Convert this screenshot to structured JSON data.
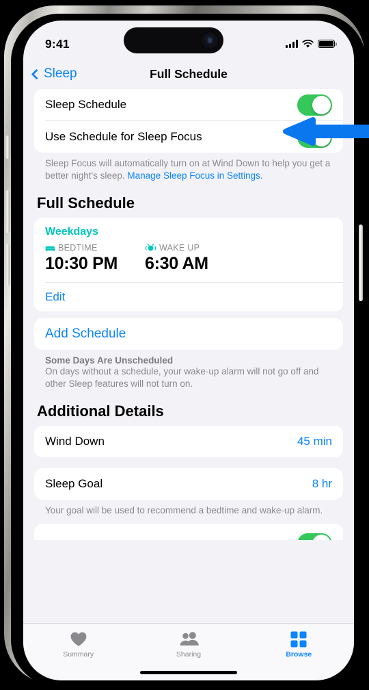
{
  "status_bar": {
    "time": "9:41",
    "cellular_icon": "cellular-bars-icon",
    "wifi_icon": "wifi-icon",
    "battery_icon": "battery-full-icon"
  },
  "nav": {
    "back_label": "Sleep",
    "back_icon": "chevron-left-icon",
    "title": "Full Schedule"
  },
  "schedule_toggles": {
    "rows": [
      {
        "label": "Sleep Schedule",
        "state": "on"
      },
      {
        "label": "Use Schedule for Sleep Focus",
        "state": "on"
      }
    ],
    "footnote_text": "Sleep Focus will automatically turn on at Wind Down to help you get a better night's sleep. ",
    "footnote_link": "Manage Sleep Focus in Settings."
  },
  "full_schedule": {
    "section_title": "Full Schedule",
    "weekdays_label": "Weekdays",
    "bedtime": {
      "icon": "bed-icon",
      "caption": "BEDTIME",
      "time": "10:30 PM"
    },
    "wake_up": {
      "icon": "alarm-clock-icon",
      "caption": "WAKE UP",
      "time": "6:30 AM"
    },
    "edit_label": "Edit",
    "add_schedule_label": "Add Schedule",
    "unscheduled_title": "Some Days Are Unscheduled",
    "unscheduled_text": "On days without a schedule, your wake-up alarm will not go off and other Sleep features will not turn on."
  },
  "additional_details": {
    "section_title": "Additional Details",
    "rows": [
      {
        "label": "Wind Down",
        "value": "45 min"
      },
      {
        "label": "Sleep Goal",
        "value": "8 hr"
      }
    ],
    "sleep_goal_footnote": "Your goal will be used to recommend a bedtime and wake-up alarm."
  },
  "tab_bar": {
    "tabs": [
      {
        "label": "Summary",
        "icon": "heart-icon",
        "active": false
      },
      {
        "label": "Sharing",
        "icon": "people-icon",
        "active": false
      },
      {
        "label": "Browse",
        "icon": "grid-squares-icon",
        "active": true
      }
    ]
  },
  "annotation": {
    "arrow_icon": "left-pointing-arrow",
    "target": "sleep-schedule-toggle"
  },
  "colors": {
    "accent_blue": "#0a84ff",
    "toggle_green": "#34c759",
    "teal": "#00c7be",
    "background": "#f2f2f7",
    "card": "#ffffff",
    "secondary_text": "#8a8a8e",
    "annotation_blue": "#0b77ef"
  }
}
